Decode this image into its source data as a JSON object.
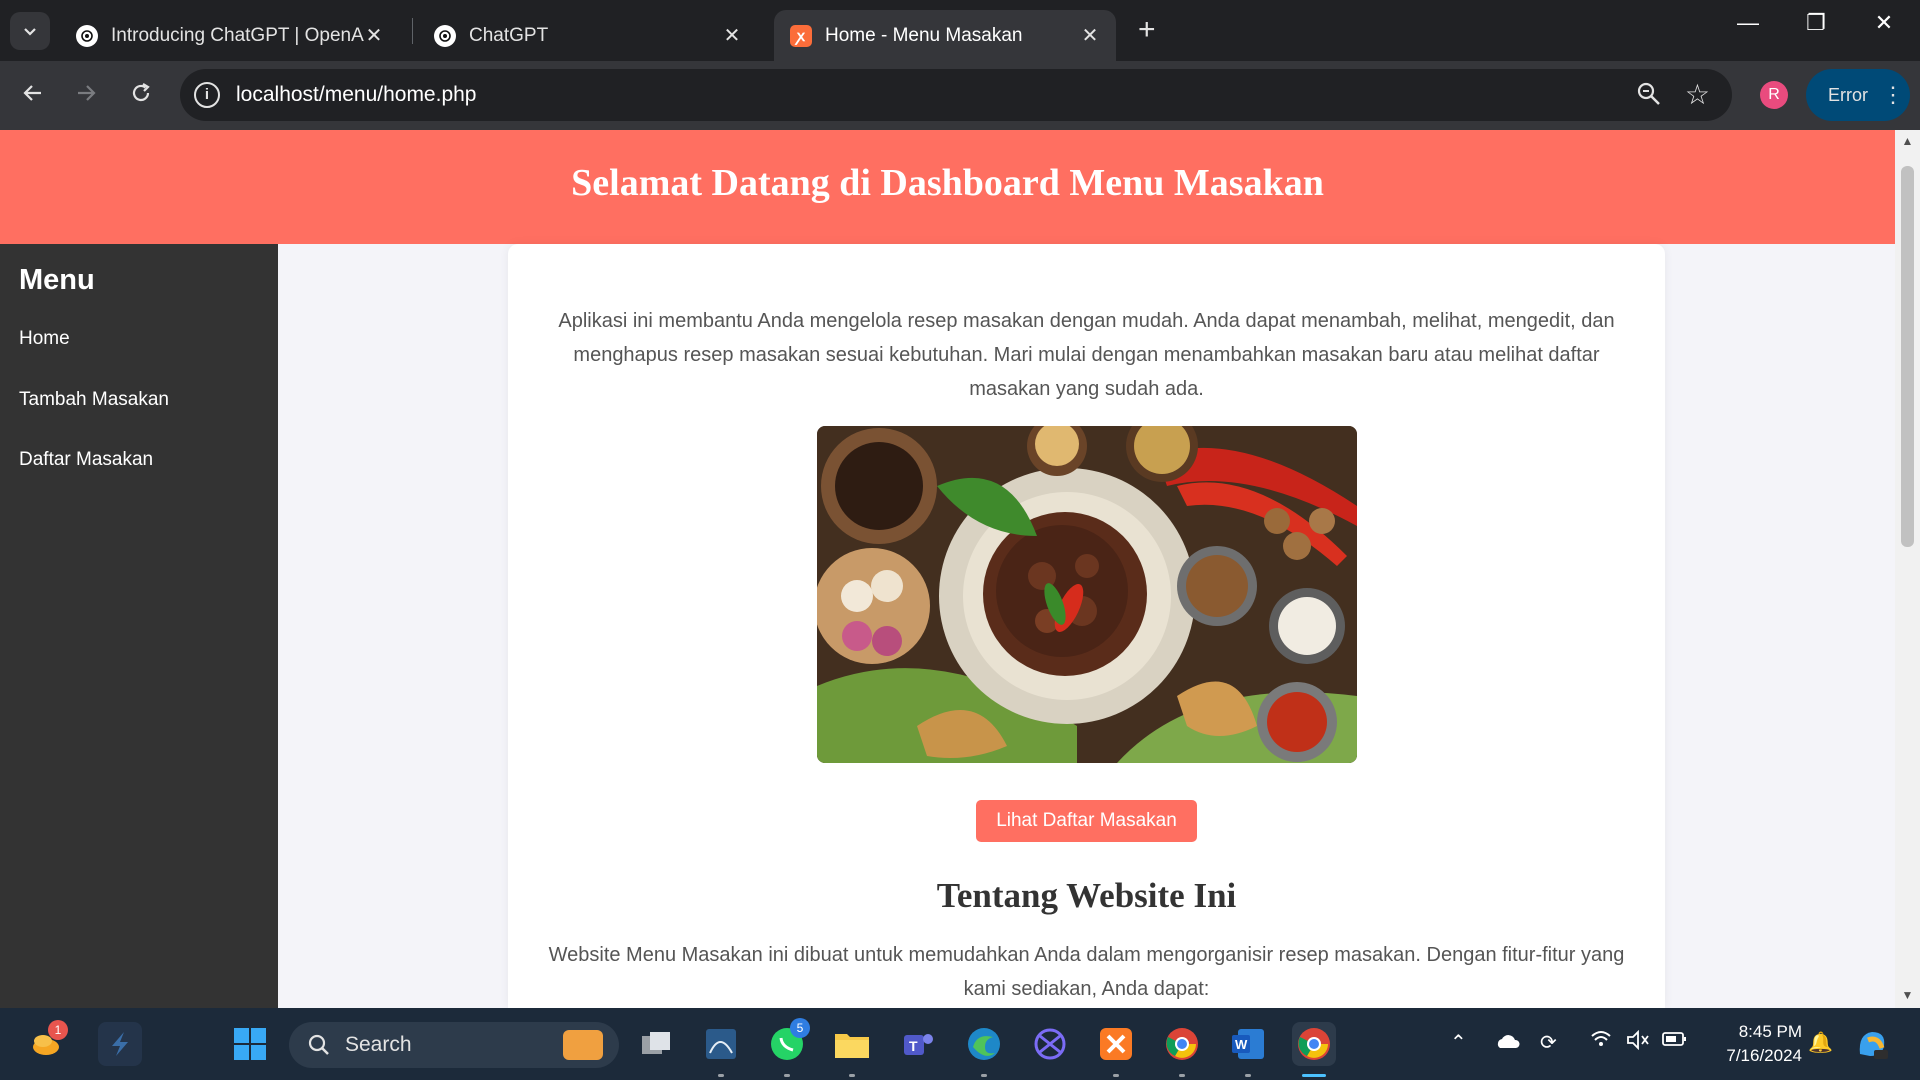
{
  "browser": {
    "tabs": [
      {
        "title": "Introducing ChatGPT | OpenAI",
        "close": "✕"
      },
      {
        "title": "ChatGPT",
        "close": "✕"
      },
      {
        "title": "Home - Menu Masakan",
        "close": "✕"
      }
    ],
    "new_tab": "+",
    "window_controls": {
      "minimize": "—",
      "restore": "❐",
      "close": "✕"
    },
    "url": "localhost/menu/home.php",
    "profile_initial": "R",
    "error_label": "Error"
  },
  "page": {
    "header_title": "Selamat Datang di Dashboard Menu Masakan",
    "sidebar": {
      "title": "Menu",
      "links": [
        "Home",
        "Tambah Masakan",
        "Daftar Masakan"
      ]
    },
    "intro": "Aplikasi ini membantu Anda mengelola resep masakan dengan mudah. Anda dapat menambah, melihat, mengedit, dan menghapus resep masakan sesuai kebutuhan. Mari mulai dengan menambahkan masakan baru atau melihat daftar masakan yang sudah ada.",
    "cta_label": "Lihat Daftar Masakan",
    "about_title": "Tentang Website Ini",
    "about_text": "Website Menu Masakan ini dibuat untuk memudahkan Anda dalam mengorganisir resep masakan. Dengan fitur-fitur yang kami sediakan, Anda dapat:",
    "colors": {
      "accent": "#ff6f61",
      "sidebar": "#333333",
      "background": "#f4f4f9"
    }
  },
  "taskbar": {
    "search_placeholder": "Search",
    "notification_badge": "1",
    "whatsapp_badge": "5",
    "time": "8:45 PM",
    "date": "7/16/2024",
    "icons": [
      "widgets-icon",
      "app-icon",
      "windows-start-icon",
      "search-icon",
      "task-view-icon",
      "mysql-icon",
      "whatsapp-icon",
      "file-explorer-icon",
      "teams-icon",
      "edge-icon",
      "perplexity-icon",
      "xampp-icon",
      "chrome-icon",
      "word-icon",
      "chrome-profile-icon"
    ]
  }
}
